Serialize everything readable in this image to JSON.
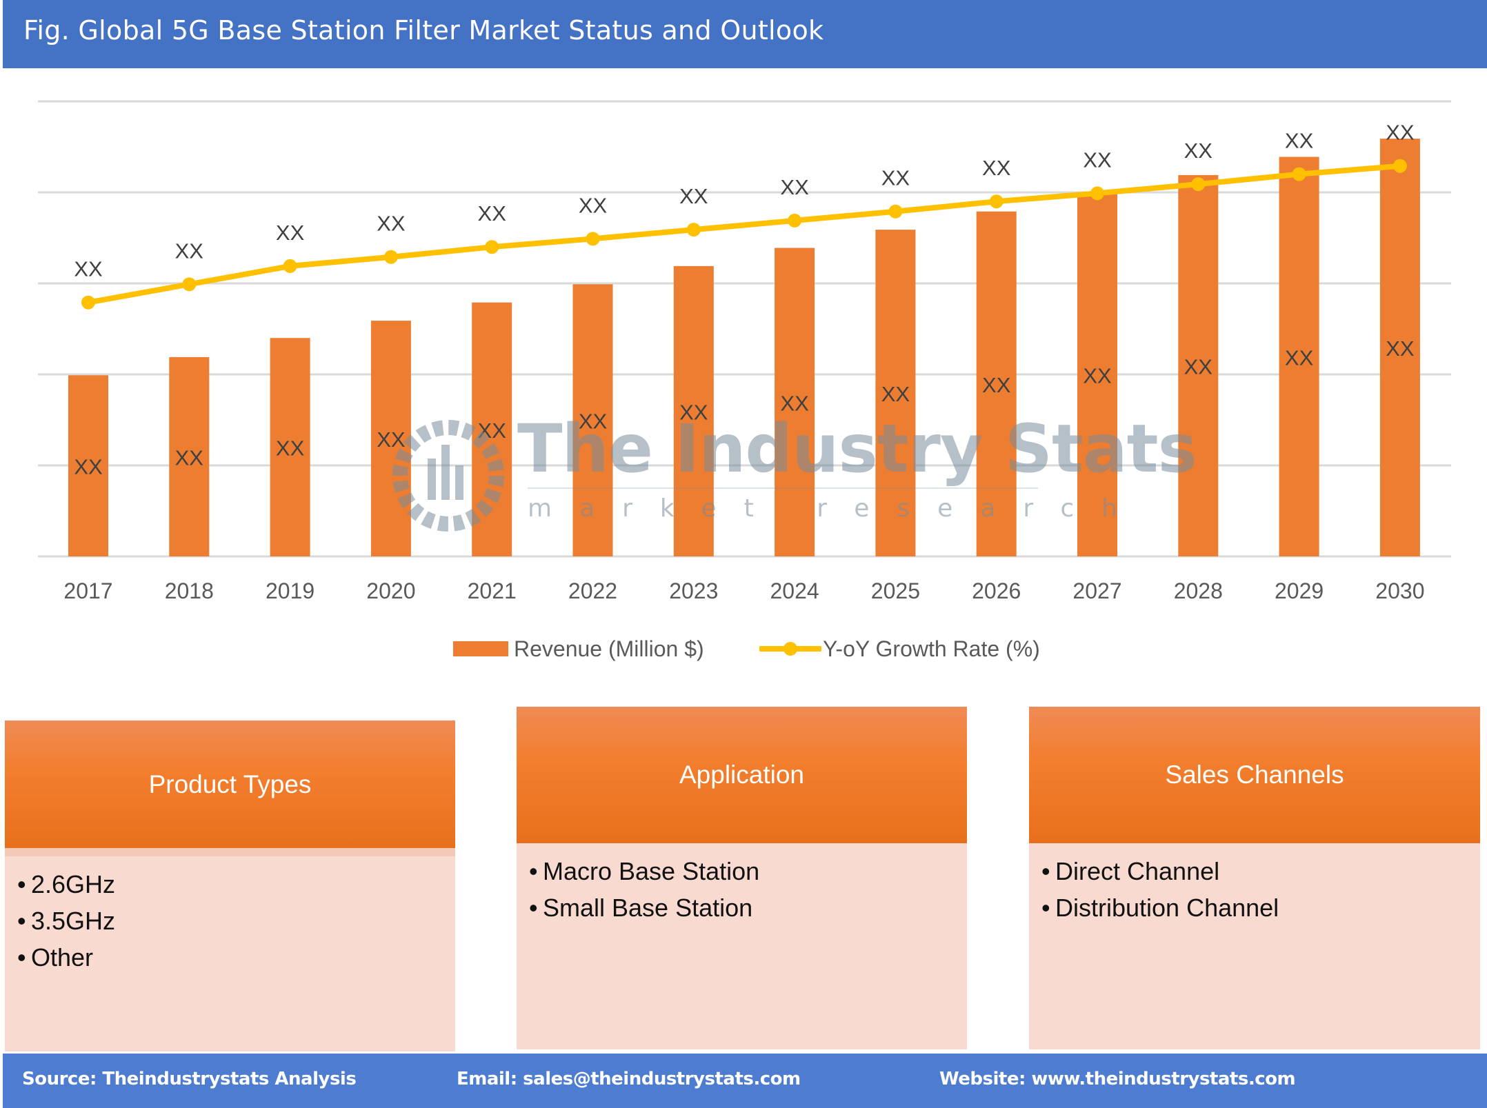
{
  "header": {
    "title": "Fig. Global 5G Base Station Filter Market Status and Outlook"
  },
  "colors": {
    "header_bg": "#4472C4",
    "bar": "#ED7D31",
    "line": "#FFC000",
    "gridline": "#D9D9D9",
    "box_body": "#F8DAD0",
    "footer_bg": "#4D7CD1"
  },
  "chart_data": {
    "type": "bar",
    "title": "Fig. Global 5G Base Station Filter Market Status and Outlook",
    "xlabel": "",
    "ylabel": "",
    "categories": [
      "2017",
      "2018",
      "2019",
      "2020",
      "2021",
      "2022",
      "2023",
      "2024",
      "2025",
      "2026",
      "2027",
      "2028",
      "2029",
      "2030"
    ],
    "series": [
      {
        "name": "Revenue (Million $)",
        "kind": "bar",
        "values": [
          1.99,
          2.19,
          2.4,
          2.59,
          2.79,
          2.99,
          3.19,
          3.39,
          3.59,
          3.79,
          3.99,
          4.19,
          4.39,
          4.59
        ],
        "labels": [
          "XX",
          "XX",
          "XX",
          "XX",
          "XX",
          "XX",
          "XX",
          "XX",
          "XX",
          "XX",
          "XX",
          "XX",
          "XX",
          "XX"
        ]
      },
      {
        "name": "Y-oY Growth Rate (%)",
        "kind": "line",
        "values": [
          2.79,
          2.99,
          3.19,
          3.29,
          3.4,
          3.49,
          3.59,
          3.69,
          3.79,
          3.9,
          3.99,
          4.09,
          4.2,
          4.29
        ],
        "labels": [
          "XX",
          "XX",
          "XX",
          "XX",
          "XX",
          "XX",
          "XX",
          "XX",
          "XX",
          "XX",
          "XX",
          "XX",
          "XX",
          "XX"
        ]
      }
    ],
    "ylim": [
      0,
      5
    ],
    "value_note": "Actual values are masked as 'XX'; numeric values are relative estimates in gridline units",
    "y_tick_labels_visible": false,
    "grid": true,
    "legend": "bottom-center"
  },
  "legend": {
    "revenue_label": "Revenue (Million $)",
    "growth_label": "Y-oY Growth Rate (%)"
  },
  "watermark": {
    "title": "The Industry Stats",
    "subtitle": "market research"
  },
  "boxes": [
    {
      "title": "Product Types",
      "items": [
        "2.6GHz",
        "3.5GHz",
        "Other"
      ]
    },
    {
      "title": "Application",
      "items": [
        "Macro Base Station",
        "Small Base Station"
      ]
    },
    {
      "title": "Sales Channels",
      "items": [
        "Direct Channel",
        "Distribution Channel"
      ]
    }
  ],
  "footer": {
    "source": "Source: Theindustrystats Analysis",
    "email": "Email: sales@theindustrystats.com",
    "website": "Website: www.theindustrystats.com"
  }
}
